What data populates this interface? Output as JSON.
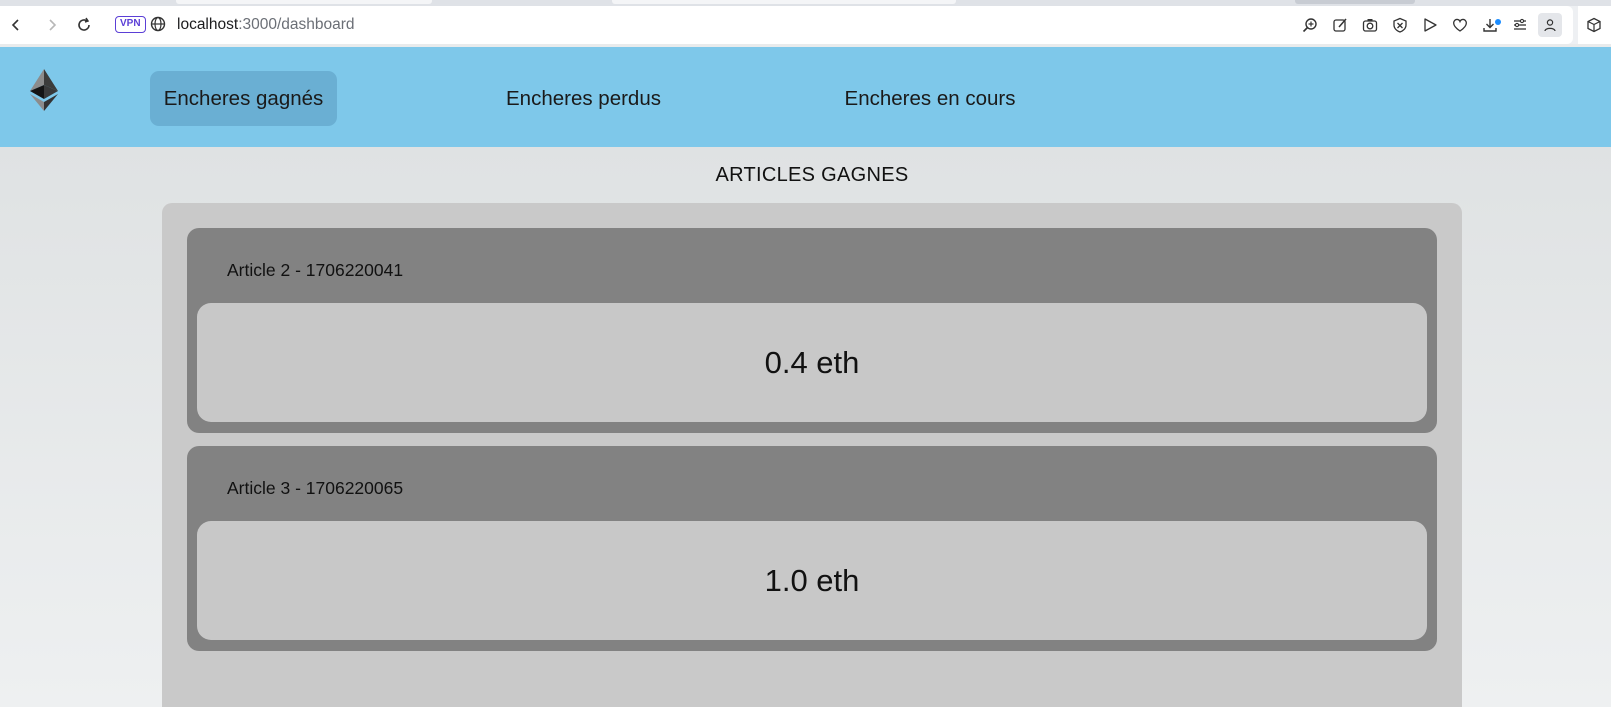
{
  "browser": {
    "url_host": "localhost",
    "url_path": ":3000/dashboard",
    "vpn_label": "VPN",
    "toolbar_icons": [
      "zoom-in-icon",
      "edit-icon",
      "camera-icon",
      "shield-icon",
      "send-icon",
      "heart-icon",
      "download-icon",
      "menu-icon",
      "profile-icon",
      "extensions-icon"
    ]
  },
  "header": {
    "logo": "ethereum-logo",
    "nav": [
      {
        "label": "Encheres gagnés",
        "active": true
      },
      {
        "label": "Encheres perdus",
        "active": false
      },
      {
        "label": "Encheres en cours",
        "active": false
      }
    ]
  },
  "main": {
    "section_title": "ARTICLES GAGNES",
    "articles": [
      {
        "title": "Article 2 - 1706220041",
        "value": "0.4 eth"
      },
      {
        "title": "Article 3 - 1706220065",
        "value": "1.0 eth"
      }
    ]
  },
  "colors": {
    "header_bg": "#7ec8ea",
    "active_tab_bg": "#6aafd3",
    "panel_bg": "#c9c9c9",
    "card_bg": "#828282",
    "value_box_bg": "#c8c8c8"
  }
}
